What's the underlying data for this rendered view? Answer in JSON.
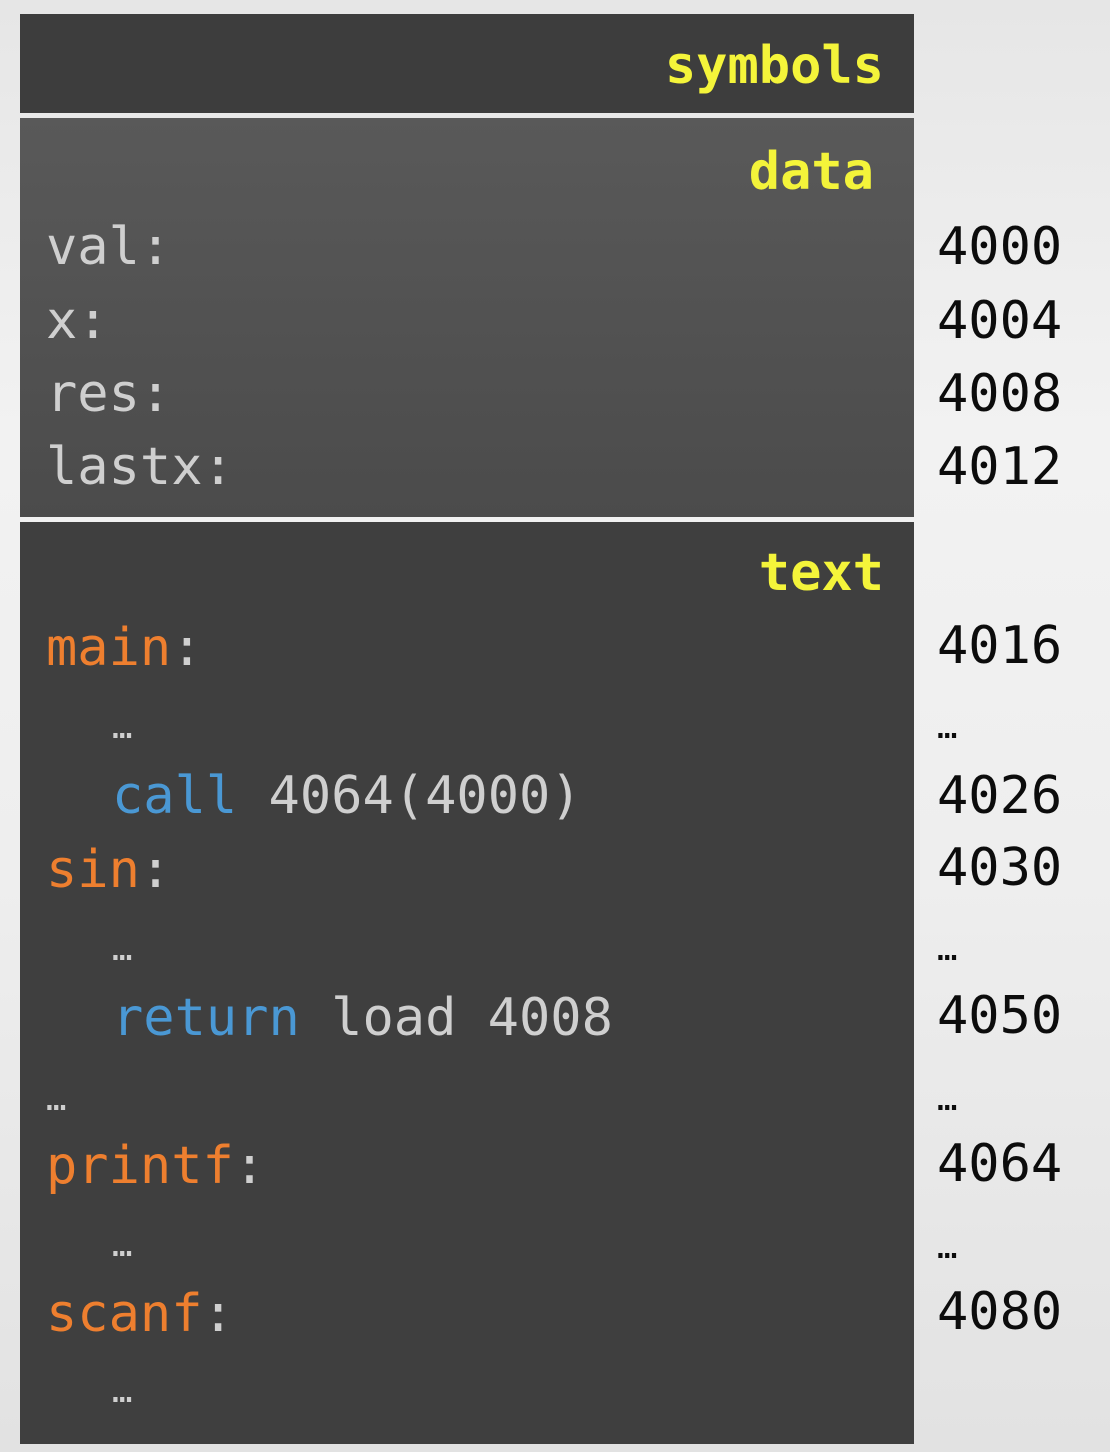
{
  "sections": {
    "symbols": "symbols",
    "data": "data",
    "text": "text"
  },
  "data_rows": [
    {
      "label": "val:",
      "addr": "4000"
    },
    {
      "label": "x:",
      "addr": "4004"
    },
    {
      "label": "res:",
      "addr": "4008"
    },
    {
      "label": "lastx:",
      "addr": "4012"
    }
  ],
  "text_rows": {
    "main_label": "main",
    "main_colon": ":",
    "main_addr": "4016",
    "main_ell": "…",
    "main_ell_addr": "…",
    "call_kw": "call",
    "call_args": " 4064(4000)",
    "call_addr": "4026",
    "sin_label": "sin",
    "sin_colon": ":",
    "sin_addr": "4030",
    "sin_ell": "…",
    "sin_ell_addr": "…",
    "return_kw": "return",
    "return_args": " load 4008",
    "return_addr": "4050",
    "gap_ell": "…",
    "gap_ell_addr": "…",
    "printf_label": "printf",
    "printf_colon": ":",
    "printf_addr": "4064",
    "printf_ell": "…",
    "printf_ell_addr": "…",
    "scanf_label": "scanf",
    "scanf_colon": ":",
    "scanf_addr": "4080",
    "scanf_ell": "…"
  },
  "colors": {
    "section_title": "#f4f43a",
    "label": "#ee7f2f",
    "keyword": "#4a98d4",
    "code_text": "#cfcfcf",
    "address": "#0c0c0c"
  }
}
